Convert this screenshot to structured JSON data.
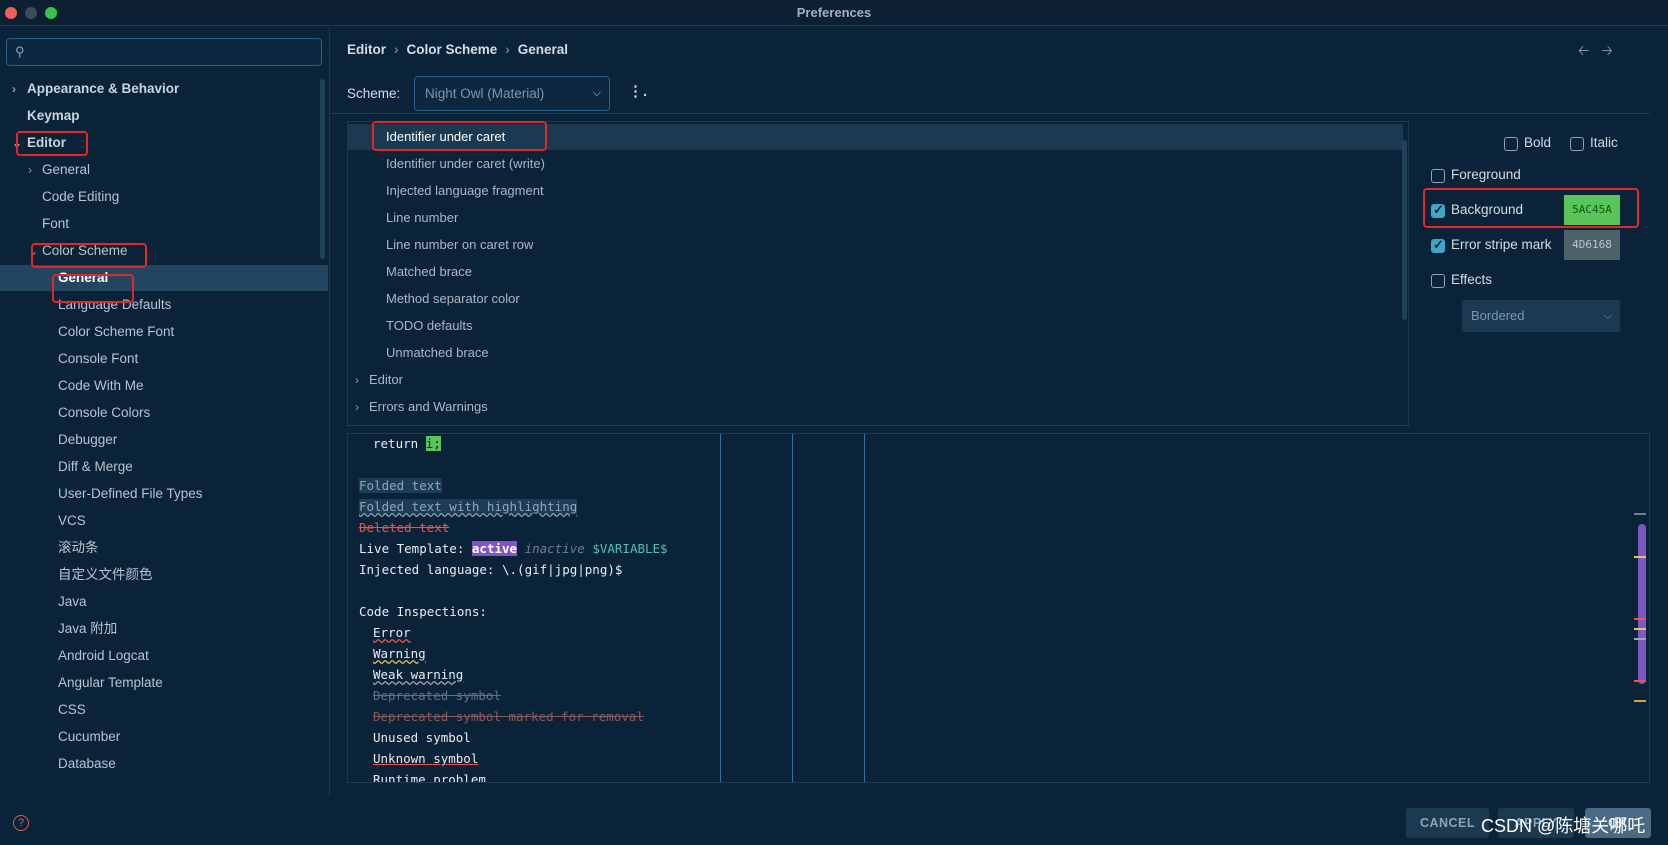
{
  "window": {
    "title": "Preferences"
  },
  "sidebar": {
    "search_placeholder": "",
    "items": [
      {
        "label": "Appearance & Behavior"
      },
      {
        "label": "Keymap"
      },
      {
        "label": "Editor"
      },
      {
        "label": "General"
      },
      {
        "label": "Code Editing"
      },
      {
        "label": "Font"
      },
      {
        "label": "Color Scheme"
      },
      {
        "label": "General"
      },
      {
        "label": "Language Defaults"
      },
      {
        "label": "Color Scheme Font"
      },
      {
        "label": "Console Font"
      },
      {
        "label": "Code With Me"
      },
      {
        "label": "Console Colors"
      },
      {
        "label": "Debugger"
      },
      {
        "label": "Diff & Merge"
      },
      {
        "label": "User-Defined File Types"
      },
      {
        "label": "VCS"
      },
      {
        "label": "滚动条"
      },
      {
        "label": "自定义文件颜色"
      },
      {
        "label": "Java"
      },
      {
        "label": "Java 附加"
      },
      {
        "label": "Android Logcat"
      },
      {
        "label": "Angular Template"
      },
      {
        "label": "CSS"
      },
      {
        "label": "Cucumber"
      },
      {
        "label": "Database"
      }
    ]
  },
  "breadcrumb": [
    "Editor",
    "Color Scheme",
    "General"
  ],
  "scheme": {
    "label": "Scheme:",
    "value": "Night Owl (Material)"
  },
  "attributes": {
    "items": [
      "Identifier under caret",
      "Identifier under caret (write)",
      "Injected language fragment",
      "Line number",
      "Line number on caret row",
      "Matched brace",
      "Method separator color",
      "TODO defaults",
      "Unmatched brace"
    ],
    "groups": [
      "Editor",
      "Errors and Warnings"
    ]
  },
  "properties": {
    "bold": {
      "label": "Bold",
      "checked": false
    },
    "italic": {
      "label": "Italic",
      "checked": false
    },
    "foreground": {
      "label": "Foreground",
      "checked": false
    },
    "background": {
      "label": "Background",
      "checked": true,
      "color": "5AC45A",
      "hex": "#5AC45A"
    },
    "error_stripe": {
      "label": "Error stripe mark",
      "checked": true,
      "color": "4D6168",
      "hex": "#4D6168"
    },
    "effects": {
      "label": "Effects",
      "checked": false,
      "type": "Bordered"
    }
  },
  "preview": {
    "return_kw": "return ",
    "return_var": "i;",
    "folded": "Folded text",
    "folded_hl": "Folded text with highlighting",
    "deleted": "Deleted text",
    "live_template_prefix": "Live Template: ",
    "live_active": "active",
    "live_inactive": "inactive",
    "live_variable": "$VARIABLE$",
    "injected": "Injected language: \\.(gif|jpg|png)$",
    "inspections_header": "Code Inspections:",
    "error": "Error",
    "warning": "Warning",
    "weak_warning": "Weak warning",
    "deprecated": "Deprecated symbol",
    "deprecated_removal": "Deprecated symbol marked for removal",
    "unused": "Unused symbol",
    "unknown": "Unknown symbol",
    "runtime": "Runtime problem"
  },
  "buttons": {
    "cancel": "CANCEL",
    "apply": "APPLY",
    "ok": "OK"
  },
  "watermark": "CSDN @陈塘关哪吒",
  "colors": {
    "background": "#0b2338",
    "highlight_border": "#e3262a",
    "checkbox_accent": "#3fa6c4",
    "live_template_active": "#7e57c2"
  }
}
